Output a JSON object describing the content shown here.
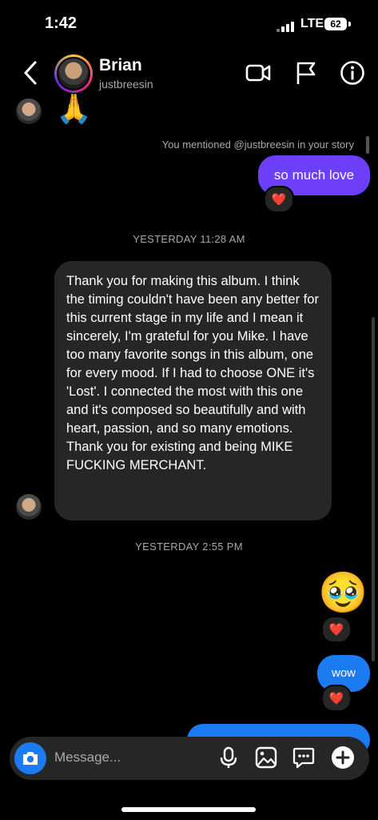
{
  "status_bar": {
    "time": "1:42",
    "network": "LTE",
    "battery": "62"
  },
  "header": {
    "name": "Brian",
    "username": "justbreesin"
  },
  "messages": {
    "top_emoji": "🙏",
    "mention_note": "You mentioned @justbreesin in your story",
    "out1": "so much love",
    "reaction": "❤️",
    "timestamp1": "YESTERDAY 11:28 AM",
    "long_message": "Thank you for making this album. I think the timing couldn't have been any better for this current stage in my life and I mean it sincerely, I'm grateful for you Mike. I have too many favorite songs in this album, one for every mood. If I had to choose ONE it's 'Lost'. I connected the most with this one and it's composed so beautifully and with heart, passion, and so many emotions. Thank you for existing and being MIKE FUCKING MERCHANT.",
    "timestamp2": "YESTERDAY 2:55 PM",
    "emoji_msg": "🥹",
    "out2": "wow"
  },
  "composer": {
    "placeholder": "Message..."
  }
}
